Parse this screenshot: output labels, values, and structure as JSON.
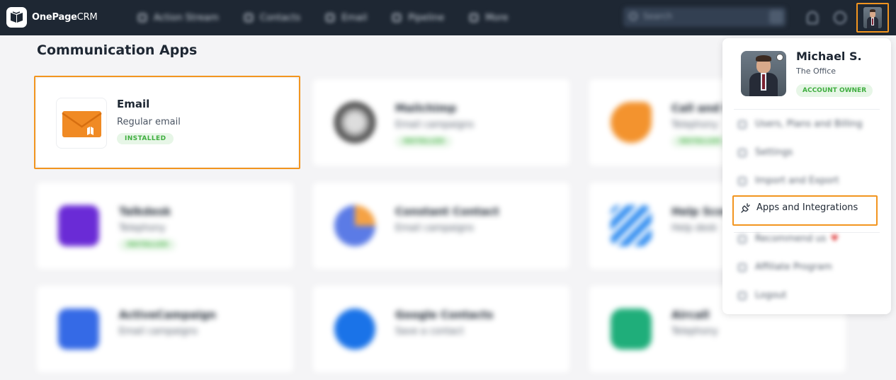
{
  "app": {
    "logo_main": "OnePage",
    "logo_suffix": "CRM"
  },
  "nav": {
    "items": [
      {
        "label": "Action Stream",
        "icon": "action-stream-icon"
      },
      {
        "label": "Contacts",
        "icon": "contacts-icon"
      },
      {
        "label": "Email",
        "icon": "email-icon"
      },
      {
        "label": "Pipeline",
        "icon": "pipeline-icon"
      },
      {
        "label": "More",
        "icon": "more-icon"
      }
    ],
    "search_placeholder": "Search"
  },
  "page": {
    "title": "Communication Apps",
    "cards": [
      {
        "title": "Email",
        "subtitle": "Regular email",
        "badge": "INSTALLED"
      },
      {
        "title": "Mailchimp",
        "subtitle": "Email campaigns",
        "badge": "INSTALLED"
      },
      {
        "title": "Call and Record",
        "subtitle": "Telephony",
        "badge": "INSTALLED"
      },
      {
        "title": "Talkdesk",
        "subtitle": "Telephony",
        "badge": "INSTALLED"
      },
      {
        "title": "Constant Contact",
        "subtitle": "Email campaigns",
        "badge": ""
      },
      {
        "title": "Help Scout",
        "subtitle": "Help desk",
        "badge": ""
      },
      {
        "title": "ActiveCampaign",
        "subtitle": "Email campaigns",
        "badge": ""
      },
      {
        "title": "Google Contacts",
        "subtitle": "Save a contact",
        "badge": ""
      },
      {
        "title": "Aircall",
        "subtitle": "Telephony",
        "badge": ""
      }
    ]
  },
  "user_menu": {
    "name": "Michael S.",
    "company": "The Office",
    "role_badge": "ACCOUNT OWNER",
    "items": [
      {
        "label": "Users, Plans and Billing",
        "icon": "users-icon"
      },
      {
        "label": "Settings",
        "icon": "settings-icon"
      },
      {
        "label": "Import and Export",
        "icon": "import-export-icon"
      },
      {
        "label": "Apps and Integrations",
        "icon": "plug-icon"
      },
      {
        "label": "Recommend us",
        "icon": "recommend-icon"
      },
      {
        "label": "Affiliate Program",
        "icon": "affiliate-icon"
      },
      {
        "label": "Logout",
        "icon": "logout-icon"
      }
    ]
  },
  "colors": {
    "topbar": "#1e2733",
    "highlight": "#f2951f",
    "installed_green": "#3fae3f",
    "email_orange": "#f08a24"
  }
}
